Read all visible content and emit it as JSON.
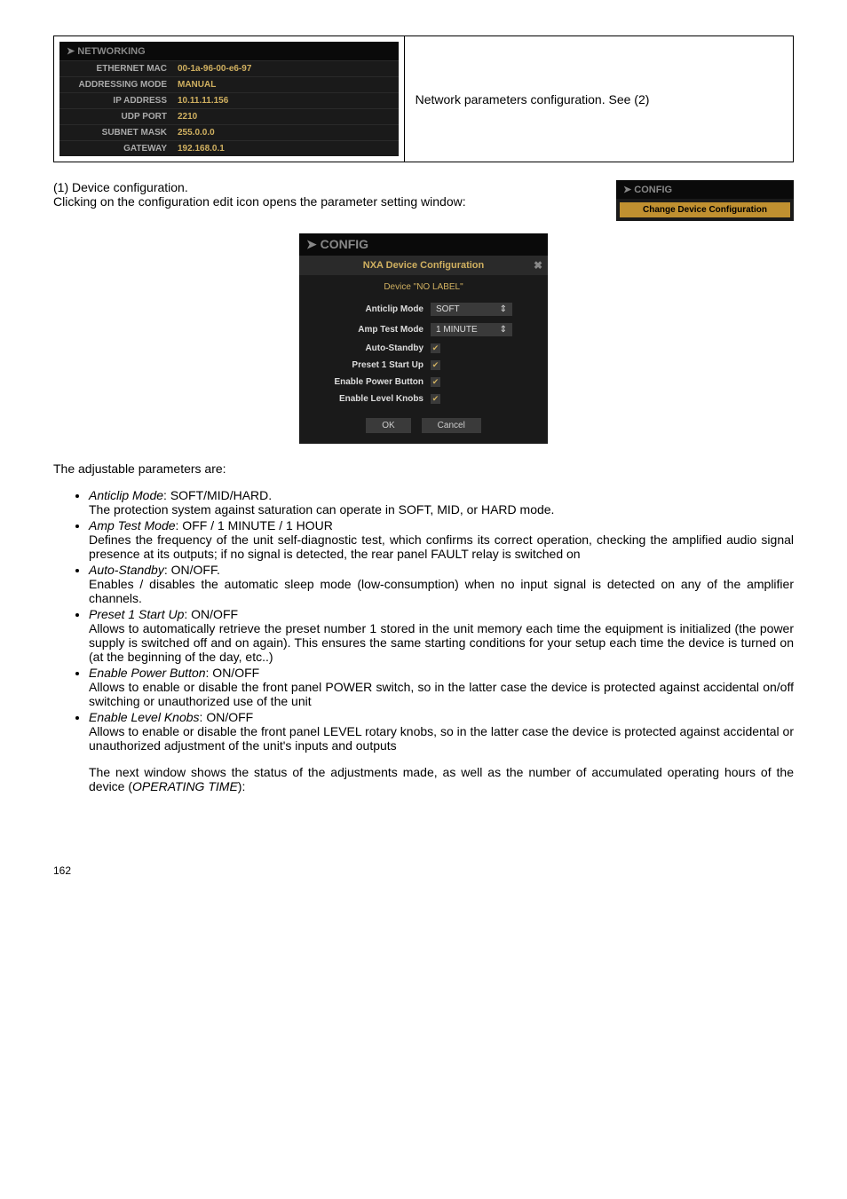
{
  "networking": {
    "header": "NETWORKING",
    "rows": [
      {
        "label": "ETHERNET MAC",
        "value": "00-1a-96-00-e6-97"
      },
      {
        "label": "ADDRESSING MODE",
        "value": "MANUAL"
      },
      {
        "label": "IP ADDRESS",
        "value": "10.11.11.156"
      },
      {
        "label": "UDP PORT",
        "value": "2210"
      },
      {
        "label": "SUBNET MASK",
        "value": "255.0.0.0"
      },
      {
        "label": "GATEWAY",
        "value": "192.168.0.1"
      }
    ]
  },
  "top_right_text": "Network parameters configuration. See (2)",
  "section1": {
    "line1": "(1) Device configuration.",
    "line2": "Clicking on the configuration edit icon opens the parameter setting window:"
  },
  "config_small": {
    "header": "CONFIG",
    "button": "Change Device Configuration"
  },
  "dialog": {
    "header": "CONFIG",
    "title": "NXA Device Configuration",
    "subtitle": "Device \"NO LABEL\"",
    "rows": [
      {
        "label": "Anticlip Mode",
        "type": "select",
        "value": "SOFT"
      },
      {
        "label": "Amp Test Mode",
        "type": "select",
        "value": "1 MINUTE"
      },
      {
        "label": "Auto-Standby",
        "type": "check",
        "checked": true
      },
      {
        "label": "Preset 1 Start Up",
        "type": "check",
        "checked": true
      },
      {
        "label": "Enable Power Button",
        "type": "check",
        "checked": true
      },
      {
        "label": "Enable Level Knobs",
        "type": "check",
        "checked": true
      }
    ],
    "ok": "OK",
    "cancel": "Cancel"
  },
  "params_intro": "The adjustable parameters are:",
  "bullets": [
    {
      "title": "Anticlip Mode",
      "after_title": ": SOFT/MID/HARD.",
      "lines": [
        "The protection system against saturation can operate in SOFT, MID, or HARD mode."
      ]
    },
    {
      "title": "Amp Test Mode",
      "after_title": ": OFF / 1 MINUTE / 1 HOUR",
      "lines": [
        "Defines the frequency of the unit self-diagnostic test, which confirms its correct operation, checking the amplified audio signal presence at its outputs; if no signal is detected, the rear panel FAULT relay is switched on"
      ]
    },
    {
      "title": "Auto-Standby",
      "after_title": ": ON/OFF.",
      "lines": [
        "Enables / disables the automatic sleep mode (low-consumption) when no input signal is detected on any of the amplifier channels."
      ]
    },
    {
      "title": "Preset 1 Start Up",
      "after_title": ": ON/OFF",
      "lines": [
        "Allows to automatically retrieve the preset number 1 stored in the unit memory each time the equipment is initialized (the power supply is switched off and on again). This ensures the same starting conditions for your setup each time the device is turned on (at the beginning of the day, etc..)"
      ]
    },
    {
      "title": "Enable Power Button",
      "after_title": ": ON/OFF",
      "lines": [
        "Allows to enable or disable the front panel POWER switch, so in the latter case the device is protected against accidental on/off switching or unauthorized use of the unit"
      ]
    },
    {
      "title": "Enable Level Knobs",
      "after_title": ": ON/OFF",
      "lines": [
        "Allows to enable or disable the front panel LEVEL rotary knobs, so in the latter case the device is protected against accidental or unauthorized adjustment of the unit's inputs and outputs"
      ]
    }
  ],
  "closing_para_pre": "The next window shows the status of the adjustments made, as well as the number of accumulated operating hours of the device (",
  "closing_para_em": "OPERATING TIME",
  "closing_para_post": "):",
  "page_number": "162"
}
